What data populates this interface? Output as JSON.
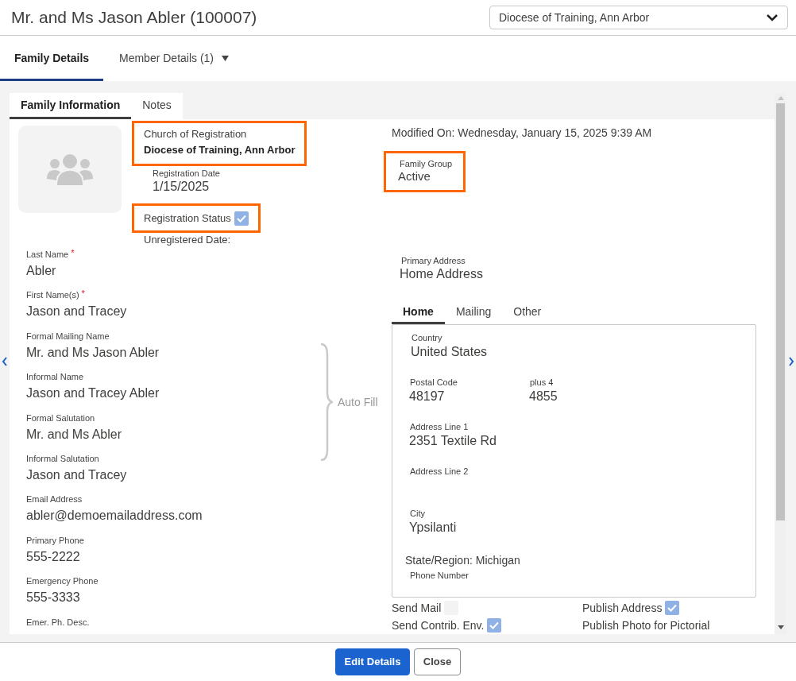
{
  "window": {
    "title": "Mr. and Ms Jason Abler (100007)"
  },
  "parish_select": {
    "value": "Diocese of Training, Ann Arbor"
  },
  "tabs": [
    {
      "label": "Family Details",
      "selected": true
    },
    {
      "label": "Member Details (1)",
      "selected": false,
      "dropdown": true
    }
  ],
  "sub_tabs": [
    {
      "label": "Family Information",
      "selected": true
    },
    {
      "label": "Notes",
      "selected": false
    }
  ],
  "church": {
    "label": "Church of Registration",
    "value": "Diocese of Training, Ann Arbor",
    "highlighted": true
  },
  "registration_date": {
    "label": "Registration Date",
    "value": "1/15/2025"
  },
  "registration_status": {
    "label": "Registration Status",
    "checked": true,
    "highlighted": true
  },
  "unregistered_date": "Unregistered Date:",
  "modified_on": "Modified On: Wednesday, January 15, 2025 9:39 AM",
  "family_group": {
    "label": "Family Group",
    "value": "Active",
    "highlighted": true
  },
  "fields": [
    {
      "label": "Last Name",
      "value": "Abler",
      "required_mark": "*"
    },
    {
      "label": "First Name(s)",
      "value": "Jason and Tracey",
      "required_mark": "*"
    },
    {
      "label": "Formal Mailing Name",
      "value": "Mr. and Ms Jason Abler"
    },
    {
      "label": "Informal Name",
      "value": "Jason and Tracey Abler"
    },
    {
      "label": "Formal Salutation",
      "value": "Mr. and Ms Abler"
    },
    {
      "label": "Informal Salutation",
      "value": "Jason and Tracey"
    },
    {
      "label": "Email Address",
      "value": "abler@demoemailaddress.com"
    },
    {
      "label": "Primary Phone",
      "value": "555-2222"
    },
    {
      "label": "Emergency Phone",
      "value": "555-3333"
    },
    {
      "label": "Emer. Ph. Desc."
    }
  ],
  "auto_fill": "Auto Fill",
  "primary_address": {
    "label": "Primary Address",
    "value": "Home Address"
  },
  "address_tabs": [
    {
      "label": "Home",
      "selected": true
    },
    {
      "label": "Mailing",
      "selected": false
    },
    {
      "label": "Other",
      "selected": false
    }
  ],
  "address_rows": [
    [
      {
        "label": "Country",
        "value": "United States"
      }
    ],
    [
      {
        "label": "Postal Code",
        "value": "48197"
      },
      {
        "label": "plus 4",
        "value": "4855"
      }
    ],
    [
      {
        "label": "Address Line 1",
        "value": "2351 Textile Rd"
      }
    ],
    [
      {
        "label": "Address Line 2"
      }
    ],
    [
      {
        "label": "City",
        "value": "Ypsilanti"
      }
    ]
  ],
  "state_region": "State/Region: Michigan",
  "phone_number": {
    "label": "Phone Number"
  },
  "options": [
    {
      "label": "Send Mail",
      "kind": "checkbox",
      "checked": false
    },
    {
      "label": "Publish Address",
      "kind": "checkbox",
      "checked": true
    },
    {
      "label": "Send Contrib. Env.",
      "kind": "checkbox",
      "checked": true
    },
    {
      "label": "Publish Photo for Pictorial",
      "kind": "text"
    }
  ],
  "buttons": [
    {
      "label": "Edit Details",
      "kind": "primary"
    },
    {
      "label": "Close",
      "kind": "secondary"
    }
  ]
}
